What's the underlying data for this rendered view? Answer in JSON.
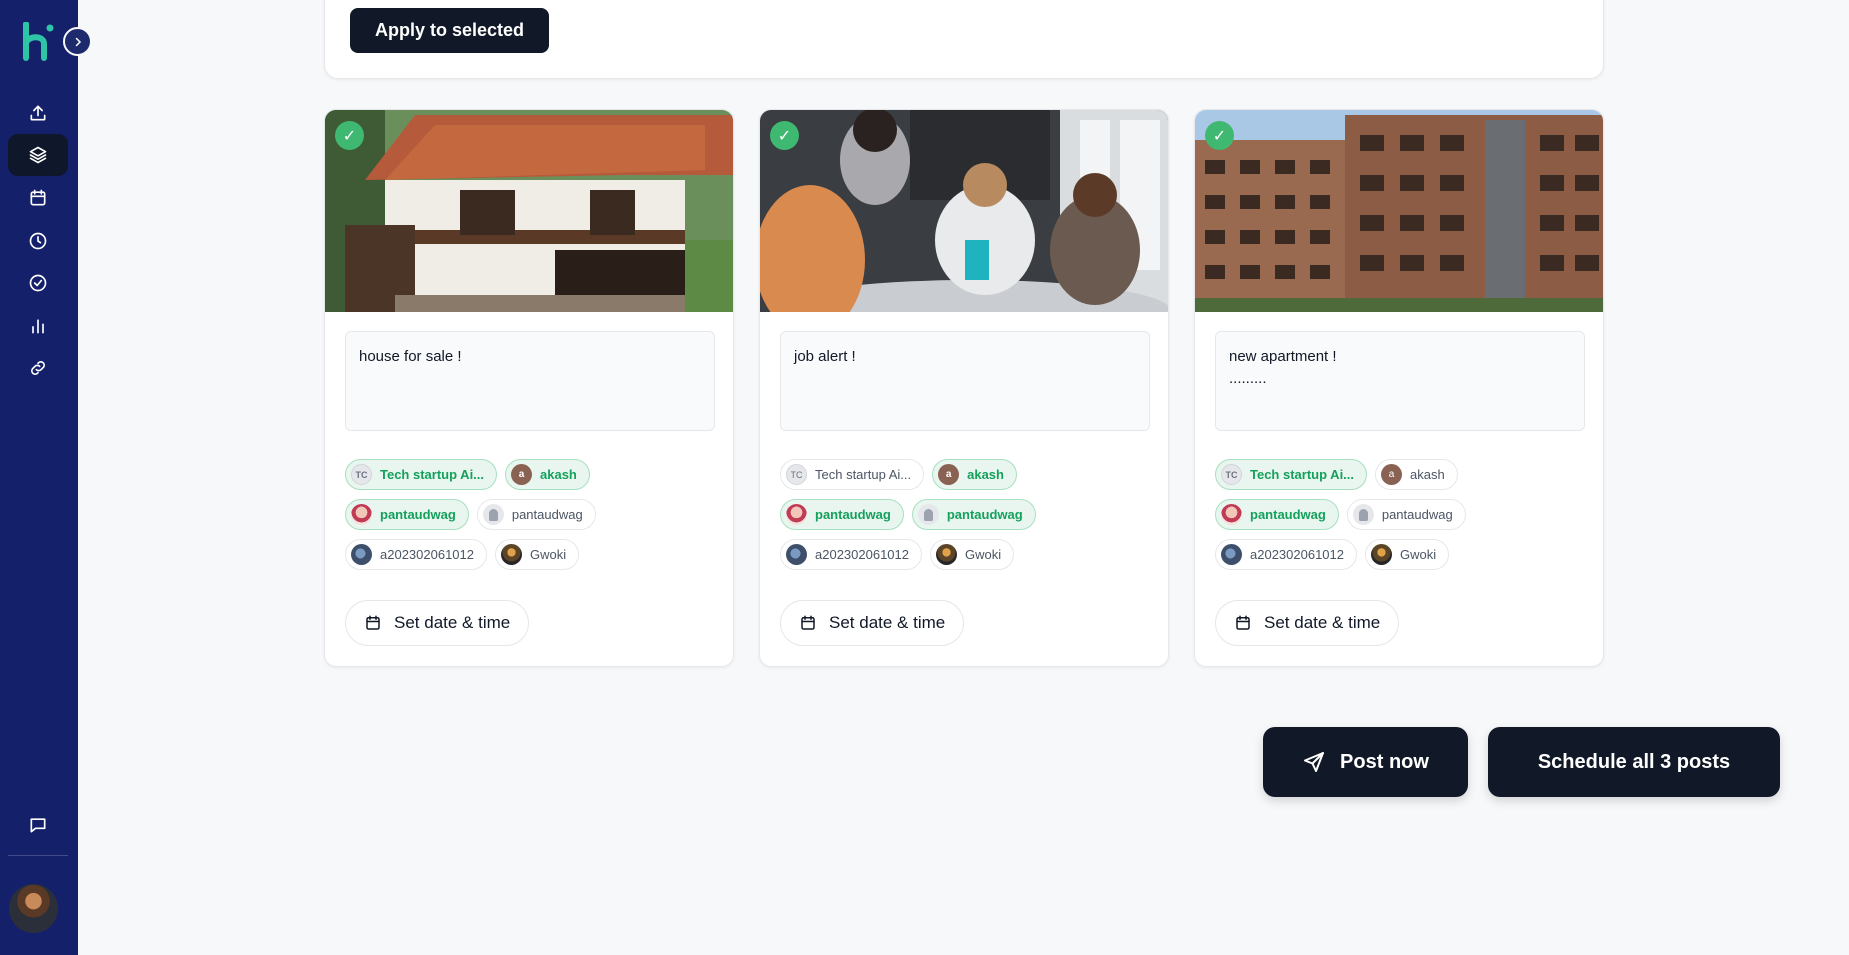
{
  "app": {
    "logo_text": "h",
    "brand_color": "#2ec4a6",
    "sidebar_color": "#15206b"
  },
  "sidebar": {
    "items": [
      {
        "icon": "upload-icon",
        "active": false
      },
      {
        "icon": "layers-icon",
        "active": true
      },
      {
        "icon": "calendar-icon",
        "active": false
      },
      {
        "icon": "clock-icon",
        "active": false
      },
      {
        "icon": "check-circle-icon",
        "active": false
      },
      {
        "icon": "bar-chart-icon",
        "active": false
      },
      {
        "icon": "link-icon",
        "active": false
      }
    ],
    "bottom": {
      "icon": "message-icon"
    }
  },
  "toolbar": {
    "apply_label": "Apply to selected"
  },
  "cards": [
    {
      "image": "house",
      "selected": true,
      "caption": "house for sale !",
      "accounts": [
        [
          {
            "label": "Tech startup Ai...",
            "avatar": "TC",
            "selected": true
          },
          {
            "label": "akash",
            "avatar": "a",
            "selected": true
          }
        ],
        [
          {
            "label": "pantaudwag",
            "avatar": "",
            "selected": true
          },
          {
            "label": "pantaudwag",
            "avatar": "",
            "selected": false
          }
        ],
        [
          {
            "label": "a202302061012",
            "avatar": "",
            "selected": false
          },
          {
            "label": "Gwoki",
            "avatar": "",
            "selected": false
          }
        ]
      ],
      "date_label": "Set date & time"
    },
    {
      "image": "office",
      "selected": true,
      "caption": "job alert !",
      "accounts": [
        [
          {
            "label": "Tech startup Ai...",
            "avatar": "TC",
            "selected": false
          },
          {
            "label": "akash",
            "avatar": "a",
            "selected": true
          }
        ],
        [
          {
            "label": "pantaudwag",
            "avatar": "",
            "selected": true
          },
          {
            "label": "pantaudwag",
            "avatar": "",
            "selected": true
          }
        ],
        [
          {
            "label": "a202302061012",
            "avatar": "",
            "selected": false
          },
          {
            "label": "Gwoki",
            "avatar": "",
            "selected": false
          }
        ]
      ],
      "date_label": "Set date & time"
    },
    {
      "image": "apartment",
      "selected": true,
      "caption": "new apartment !\n.........",
      "accounts": [
        [
          {
            "label": "Tech startup Ai...",
            "avatar": "TC",
            "selected": true
          },
          {
            "label": "akash",
            "avatar": "a",
            "selected": false
          }
        ],
        [
          {
            "label": "pantaudwag",
            "avatar": "",
            "selected": true
          },
          {
            "label": "pantaudwag",
            "avatar": "",
            "selected": false
          }
        ],
        [
          {
            "label": "a202302061012",
            "avatar": "",
            "selected": false
          },
          {
            "label": "Gwoki",
            "avatar": "",
            "selected": false
          }
        ]
      ],
      "date_label": "Set date & time"
    }
  ],
  "actions": {
    "post_now_label": "Post now",
    "schedule_all_label": "Schedule all 3 posts"
  }
}
